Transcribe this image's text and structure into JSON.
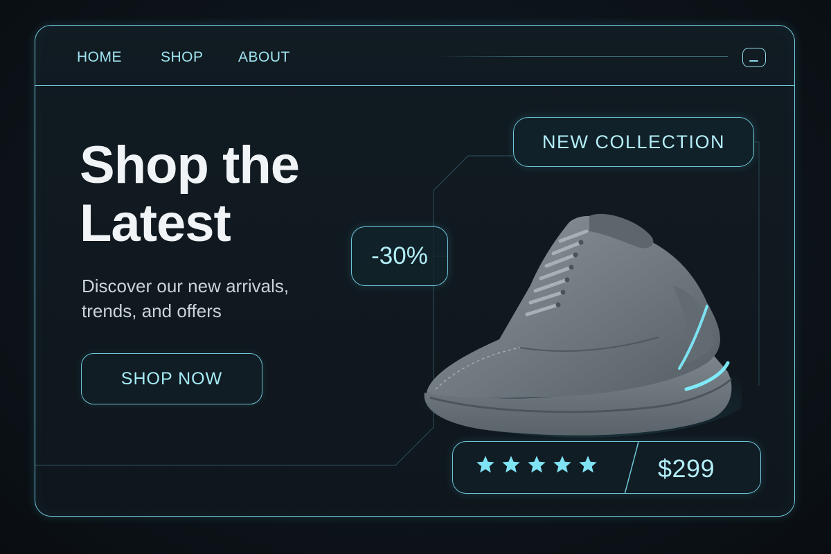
{
  "nav": {
    "items": [
      "HOME",
      "SHOP",
      "ABOUT"
    ],
    "menu_icon": "menu-icon"
  },
  "hero": {
    "title": "Shop the Latest",
    "subtitle": "Discover our new arrivals, trends, and offers",
    "cta": "SHOP NOW"
  },
  "product": {
    "collection_tag": "NEW COLLECTION",
    "discount": "-30%",
    "rating": 5,
    "rating_max": 5,
    "price": "$299",
    "image": "sneaker-image"
  },
  "colors": {
    "accent": "#6fc6d8",
    "accent_text": "#a6ecf7",
    "background": "#0d151b",
    "title_text": "#f1f4f6",
    "star": "#7fe3f4"
  }
}
